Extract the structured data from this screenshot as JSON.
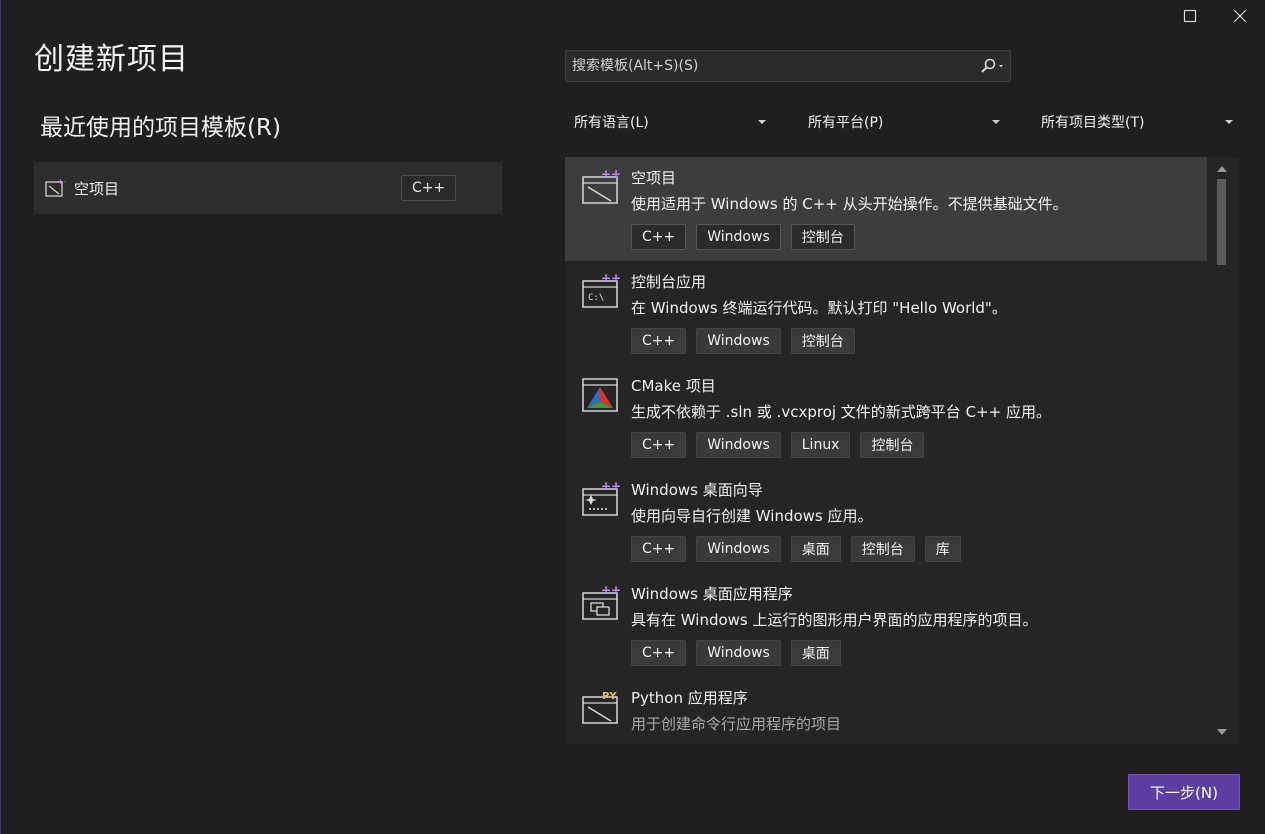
{
  "window": {
    "maximize_glyph": "☐",
    "close_glyph": "✕"
  },
  "page_title": "创建新项目",
  "recent": {
    "title": "最近使用的项目模板(R)",
    "items": [
      {
        "label": "空项目",
        "tag": "C++",
        "icon": "empty-project-icon"
      }
    ]
  },
  "search": {
    "placeholder": "搜索模板(Alt+S)(S)",
    "icon": "search-icon"
  },
  "filters": {
    "language": "所有语言(L)",
    "platform": "所有平台(P)",
    "project_type": "所有项目类型(T)"
  },
  "templates": [
    {
      "name": "空项目",
      "description": "使用适用于 Windows 的 C++ 从头开始操作。不提供基础文件。",
      "tags": [
        "C++",
        "Windows",
        "控制台"
      ],
      "icon": "empty-project-icon",
      "selected": true
    },
    {
      "name": "控制台应用",
      "description": "在 Windows 终端运行代码。默认打印 \"Hello World\"。",
      "tags": [
        "C++",
        "Windows",
        "控制台"
      ],
      "icon": "console-app-icon"
    },
    {
      "name": "CMake 项目",
      "description": "生成不依赖于 .sln 或 .vcxproj 文件的新式跨平台 C++ 应用。",
      "tags": [
        "C++",
        "Windows",
        "Linux",
        "控制台"
      ],
      "icon": "cmake-icon"
    },
    {
      "name": "Windows 桌面向导",
      "description": "使用向导自行创建 Windows 应用。",
      "tags": [
        "C++",
        "Windows",
        "桌面",
        "控制台",
        "库"
      ],
      "icon": "desktop-wizard-icon"
    },
    {
      "name": "Windows 桌面应用程序",
      "description": "具有在 Windows 上运行的图形用户界面的应用程序的项目。",
      "tags": [
        "C++",
        "Windows",
        "桌面"
      ],
      "icon": "desktop-app-icon"
    },
    {
      "name": "Python 应用程序",
      "description": "用于创建命令行应用程序的项目",
      "tags": [],
      "icon": "python-app-icon"
    }
  ],
  "next_button": "下一步(N)",
  "colors": {
    "background": "#1f1f1f",
    "selected_row": "#3d3d3d",
    "accent": "#5a3ea1",
    "plus_badge": "#c586ff"
  }
}
